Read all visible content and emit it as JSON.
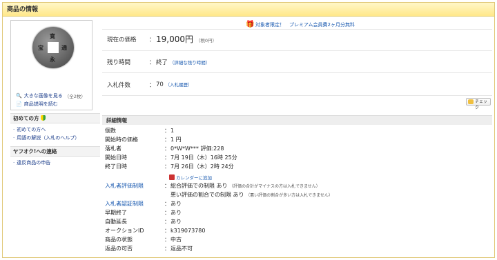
{
  "header": {
    "title": "商品の情報"
  },
  "image_box": {
    "coin_chars": [
      "寛",
      "永",
      "通",
      "宝"
    ],
    "large_image_link": "大きな画像を見る",
    "large_image_count": "（全2枚）",
    "description_link": "商品説明を読む"
  },
  "sidebar": {
    "beginners_heading": "初めての方",
    "beginners_links": [
      "初めての方へ",
      "用語の解説（入札のヘルプ）"
    ],
    "contact_heading": "ヤフオク!への連絡",
    "contact_links": [
      "違反商品の申告"
    ]
  },
  "promo": {
    "text": "対象者限定！　プレミアム会員費2ヶ月分無料"
  },
  "summary": {
    "price_label": "現在の価格",
    "price_value": "19,000円",
    "price_tax": "（税0円）",
    "time_label": "残り時間",
    "time_value": "終了",
    "time_link": "（詳細な残り時間）",
    "bids_label": "入札件数",
    "bids_value": "70",
    "bids_link": "（入札履歴）",
    "check_button": "チェック"
  },
  "detail": {
    "heading": "詳細情報",
    "rows": [
      {
        "k": "個数",
        "v": "1"
      },
      {
        "k": "開始時の価格",
        "v": "1 円"
      },
      {
        "k": "落札者",
        "v": "0*W*W*** 評価:228"
      },
      {
        "k": "開始日時",
        "v": "7月 19日（木）16時 25分"
      },
      {
        "k": "終了日時",
        "v": "7月 26日（木）2時 24分"
      }
    ],
    "calendar_link": "カレンダーに追加",
    "rating_limit_label": "入札者評価制限",
    "rating_limit_value1": "総合評価での制限 あり",
    "rating_limit_note1": "（評価の合計がマイナスの方は入札できません）",
    "rating_limit_value2": "悪い評価の割合での制限 あり",
    "rating_limit_note2": "（悪い評価の割合が多い方は入札できません）",
    "auth_label": "入札者認証制限",
    "auth_value": "あり",
    "rows2": [
      {
        "k": "早期終了",
        "v": "あり"
      },
      {
        "k": "自動延長",
        "v": "あり"
      },
      {
        "k": "オークションID",
        "v": "k319073780"
      },
      {
        "k": "商品の状態",
        "v": "中古"
      },
      {
        "k": "返品の可否",
        "v": "返品不可"
      }
    ],
    "colon": "："
  }
}
